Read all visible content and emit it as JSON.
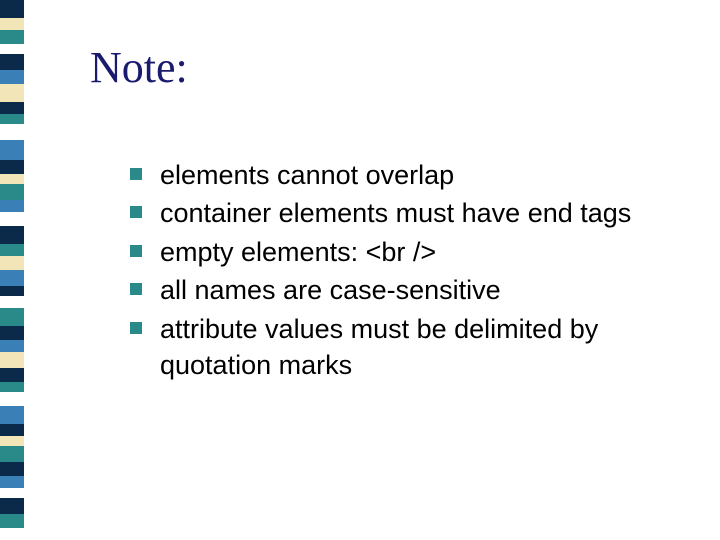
{
  "title": "Note:",
  "bullets": [
    "elements cannot overlap",
    "container elements must have end tags",
    "empty elements:  <br />",
    "all names are case-sensitive",
    "attribute values must be delimited by quotation marks"
  ],
  "stripe_colors": [
    {
      "c": "#0b2a4a",
      "h": 18
    },
    {
      "c": "#f2e6b8",
      "h": 12
    },
    {
      "c": "#2a8a8a",
      "h": 14
    },
    {
      "c": "#ffffff",
      "h": 10
    },
    {
      "c": "#0b2a4a",
      "h": 16
    },
    {
      "c": "#3a7fb5",
      "h": 14
    },
    {
      "c": "#f2e6b8",
      "h": 18
    },
    {
      "c": "#0b2a4a",
      "h": 12
    },
    {
      "c": "#2a8a8a",
      "h": 10
    },
    {
      "c": "#ffffff",
      "h": 16
    },
    {
      "c": "#3a7fb5",
      "h": 20
    },
    {
      "c": "#0b2a4a",
      "h": 14
    },
    {
      "c": "#f2e6b8",
      "h": 10
    },
    {
      "c": "#2a8a8a",
      "h": 16
    },
    {
      "c": "#3a7fb5",
      "h": 12
    },
    {
      "c": "#ffffff",
      "h": 14
    },
    {
      "c": "#0b2a4a",
      "h": 18
    },
    {
      "c": "#2a8a8a",
      "h": 12
    },
    {
      "c": "#f2e6b8",
      "h": 14
    },
    {
      "c": "#3a7fb5",
      "h": 16
    },
    {
      "c": "#0b2a4a",
      "h": 10
    },
    {
      "c": "#ffffff",
      "h": 12
    },
    {
      "c": "#2a8a8a",
      "h": 18
    },
    {
      "c": "#0b2a4a",
      "h": 14
    },
    {
      "c": "#3a7fb5",
      "h": 12
    },
    {
      "c": "#f2e6b8",
      "h": 16
    },
    {
      "c": "#0b2a4a",
      "h": 14
    },
    {
      "c": "#2a8a8a",
      "h": 10
    },
    {
      "c": "#ffffff",
      "h": 14
    },
    {
      "c": "#3a7fb5",
      "h": 18
    },
    {
      "c": "#0b2a4a",
      "h": 12
    },
    {
      "c": "#f2e6b8",
      "h": 10
    },
    {
      "c": "#2a8a8a",
      "h": 16
    },
    {
      "c": "#0b2a4a",
      "h": 14
    },
    {
      "c": "#3a7fb5",
      "h": 12
    },
    {
      "c": "#ffffff",
      "h": 10
    },
    {
      "c": "#0b2a4a",
      "h": 16
    },
    {
      "c": "#2a8a8a",
      "h": 14
    }
  ]
}
